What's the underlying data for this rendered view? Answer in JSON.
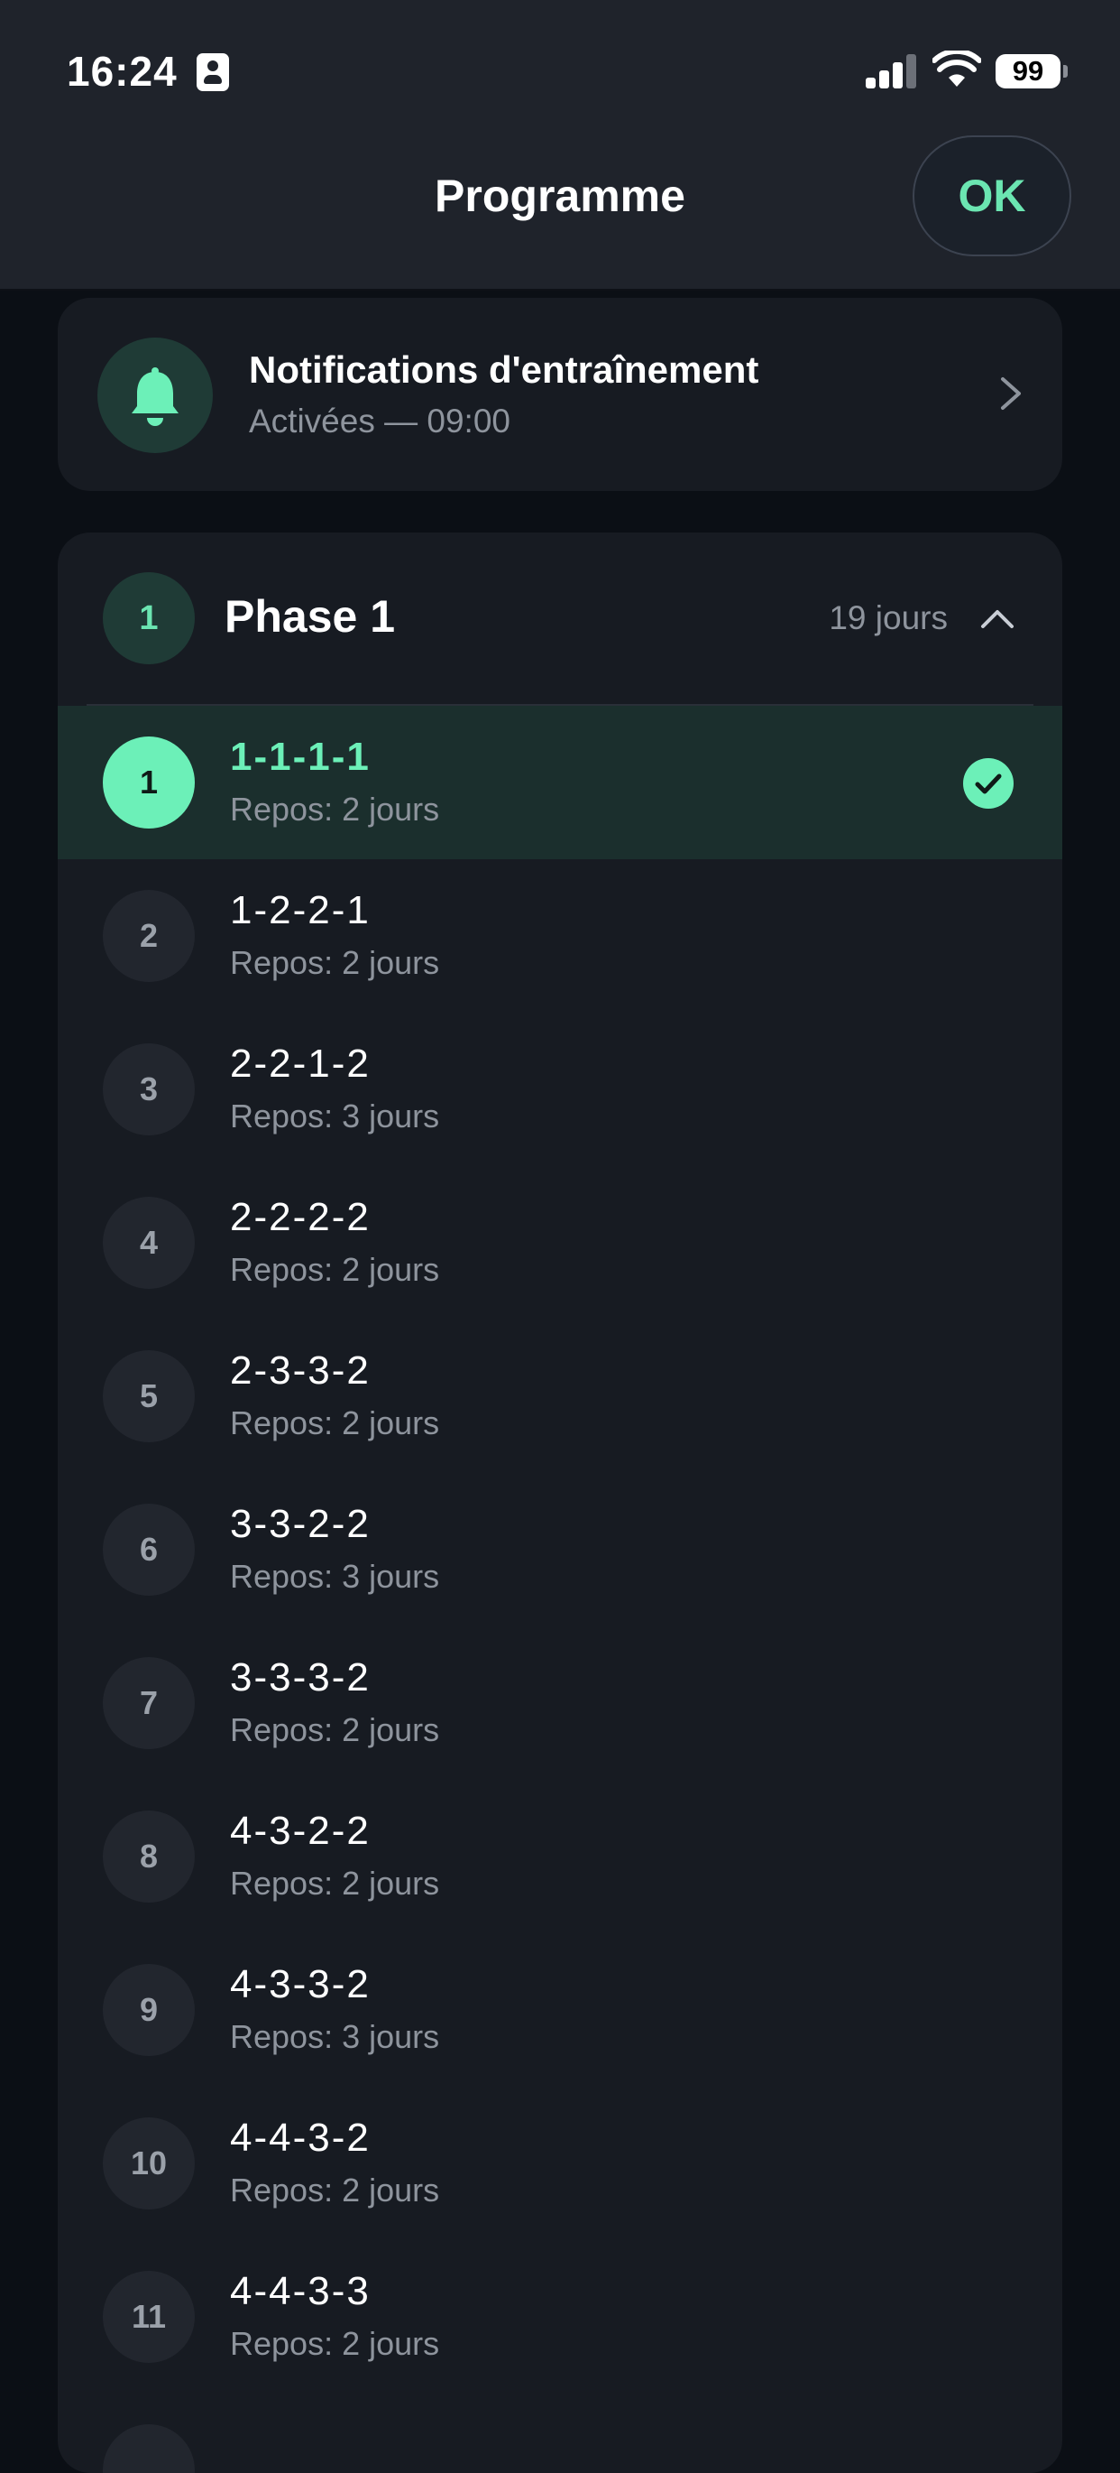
{
  "status_bar": {
    "time": "16:24",
    "battery": "99",
    "icons": [
      "person-badge-icon",
      "cellular-signal-icon",
      "wifi-icon",
      "battery-icon"
    ]
  },
  "navbar": {
    "title": "Programme",
    "ok_label": "OK"
  },
  "notifications": {
    "title": "Notifications d'entraînement",
    "subtitle": "Activées — 09:00",
    "icon": "bell-icon"
  },
  "phase": {
    "badge": "1",
    "title": "Phase 1",
    "duration": "19 jours",
    "expanded": true
  },
  "sessions": [
    {
      "number": "1",
      "title": "1-1-1-1",
      "rest": "Repos: 2 jours",
      "current": true,
      "completed": true
    },
    {
      "number": "2",
      "title": "1-2-2-1",
      "rest": "Repos: 2 jours"
    },
    {
      "number": "3",
      "title": "2-2-1-2",
      "rest": "Repos: 3 jours"
    },
    {
      "number": "4",
      "title": "2-2-2-2",
      "rest": "Repos: 2 jours"
    },
    {
      "number": "5",
      "title": "2-3-3-2",
      "rest": "Repos: 2 jours"
    },
    {
      "number": "6",
      "title": "3-3-2-2",
      "rest": "Repos: 3 jours"
    },
    {
      "number": "7",
      "title": "3-3-3-2",
      "rest": "Repos: 2 jours"
    },
    {
      "number": "8",
      "title": "4-3-2-2",
      "rest": "Repos: 2 jours"
    },
    {
      "number": "9",
      "title": "4-3-3-2",
      "rest": "Repos: 3 jours"
    },
    {
      "number": "10",
      "title": "4-4-3-2",
      "rest": "Repos: 2 jours"
    },
    {
      "number": "11",
      "title": "4-4-3-3",
      "rest": "Repos: 2 jours"
    }
  ],
  "colors": {
    "accent": "#6cf0b8",
    "background": "#0b0f15",
    "card": "#171b22",
    "bar": "#1f232b"
  }
}
